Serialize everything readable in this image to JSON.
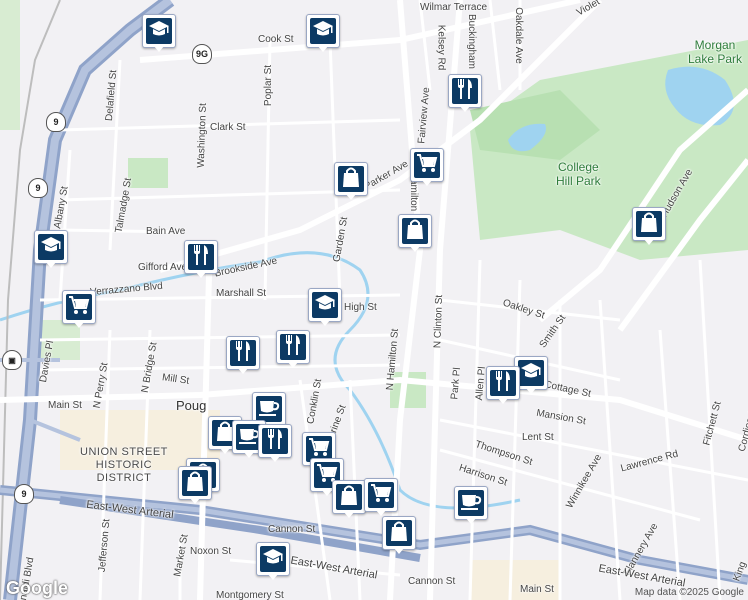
{
  "streets": [
    {
      "name": "Wilmar Terrace",
      "id": "wilmar-terrace"
    },
    {
      "name": "Violet",
      "id": "violet"
    },
    {
      "name": "Oakdale Ave",
      "id": "oakdale-ave"
    },
    {
      "name": "Buckingham",
      "id": "buckingham"
    },
    {
      "name": "Kelsey Rd",
      "id": "kelsey-rd"
    },
    {
      "name": "Cook St",
      "id": "cook-st"
    },
    {
      "name": "Poplar St",
      "id": "poplar-st"
    },
    {
      "name": "Delafield St",
      "id": "delafield-st"
    },
    {
      "name": "Clark St",
      "id": "clark-st"
    },
    {
      "name": "Fairview Ave",
      "id": "fairview-ave"
    },
    {
      "name": "Washington St",
      "id": "washington-st"
    },
    {
      "name": "Talmadge St",
      "id": "talmadge-st"
    },
    {
      "name": "Albany St",
      "id": "albany-st"
    },
    {
      "name": "Parker Ave",
      "id": "parker-ave"
    },
    {
      "name": "Hamilton",
      "id": "hamilton"
    },
    {
      "name": "Bain Ave",
      "id": "bain-ave"
    },
    {
      "name": "Garden St",
      "id": "garden-st"
    },
    {
      "name": "Gifford Ave",
      "id": "gifford-ave"
    },
    {
      "name": "Brookside Ave",
      "id": "brookside-ave"
    },
    {
      "name": "Verrazzano Blvd",
      "id": "verrazzano-blvd"
    },
    {
      "name": "Marshall St",
      "id": "marshall-st"
    },
    {
      "name": "High St",
      "id": "high-st"
    },
    {
      "name": "N Clinton St",
      "id": "n-clinton-st"
    },
    {
      "name": "Oakley St",
      "id": "oakley-st"
    },
    {
      "name": "Smith St",
      "id": "smith-st"
    },
    {
      "name": "Hudson Ave",
      "id": "hudson-ave"
    },
    {
      "name": "N Hamilton St",
      "id": "n-hamilton-st"
    },
    {
      "name": "Davies Pl",
      "id": "davies-pl"
    },
    {
      "name": "N Perry St",
      "id": "n-perry-st"
    },
    {
      "name": "N Bridge St",
      "id": "n-bridge-st"
    },
    {
      "name": "Mill St",
      "id": "mill-st"
    },
    {
      "name": "Main St",
      "id": "main-st-west"
    },
    {
      "name": "Conklin St",
      "id": "conklin-st"
    },
    {
      "name": "Catharine St",
      "id": "catharine-st"
    },
    {
      "name": "Park Pl",
      "id": "park-pl"
    },
    {
      "name": "Allen Pl",
      "id": "allen-pl"
    },
    {
      "name": "Cottage St",
      "id": "cottage-st"
    },
    {
      "name": "Mansion St",
      "id": "mansion-st"
    },
    {
      "name": "Lent St",
      "id": "lent-st"
    },
    {
      "name": "Fitchett St",
      "id": "fitchett-st"
    },
    {
      "name": "Cordies Ave",
      "id": "cordies-ave"
    },
    {
      "name": "Thompson St",
      "id": "thompson-st"
    },
    {
      "name": "Lawrence Rd",
      "id": "lawrence-rd"
    },
    {
      "name": "Harrison St",
      "id": "harrison-st"
    },
    {
      "name": "Winnikee Ave",
      "id": "winnikee-ave"
    },
    {
      "name": "East-West Arterial",
      "id": "east-west-arterial-west"
    },
    {
      "name": "Jefferson St",
      "id": "jefferson-st"
    },
    {
      "name": "Cannon St",
      "id": "cannon-st-west"
    },
    {
      "name": "Noxon St",
      "id": "noxon-st"
    },
    {
      "name": "Market St",
      "id": "market-st"
    },
    {
      "name": "East-West Arterial",
      "id": "east-west-arterial-center"
    },
    {
      "name": "Cannon St",
      "id": "cannon-st-east"
    },
    {
      "name": "Main St",
      "id": "main-st-east"
    },
    {
      "name": "Flannery Ave",
      "id": "flannery-ave"
    },
    {
      "name": "East-West Arterial",
      "id": "east-west-arterial-east"
    },
    {
      "name": "Montgomery St",
      "id": "montgomery-st"
    },
    {
      "name": "Rinaldi Blvd",
      "id": "rinaldi-blvd"
    },
    {
      "name": "King",
      "id": "king"
    }
  ],
  "areas": {
    "morgan_lake_park": "Morgan\nLake Park",
    "college_hill_park": "College\nHill Park",
    "union_street": "UNION STREET\nHISTORIC\nDISTRICT",
    "poughkeepsie": "Poug"
  },
  "shields": {
    "route_9g": "9G",
    "route_9_a": "9",
    "route_9_b": "9",
    "route_9_c": "9",
    "route_44": "9"
  },
  "attribution": "Map data ©2025 Google",
  "logo": "Google",
  "colors": {
    "pin_bg": "#0c3a64",
    "park": "#c9e8c4",
    "water": "#9fd3f0",
    "highway": "#8fa3c9",
    "major": "#ffffff"
  },
  "pins": [
    {
      "id": "school-1",
      "icon": "school"
    },
    {
      "id": "school-2",
      "icon": "school"
    },
    {
      "id": "restaurant-1",
      "icon": "restaurant"
    },
    {
      "id": "grocery-1",
      "icon": "grocery"
    },
    {
      "id": "shopping-1",
      "icon": "shopping"
    },
    {
      "id": "school-3",
      "icon": "school"
    },
    {
      "id": "restaurant-2",
      "icon": "restaurant"
    },
    {
      "id": "shopping-2",
      "icon": "shopping"
    },
    {
      "id": "shopping-3",
      "icon": "shopping"
    },
    {
      "id": "grocery-2",
      "icon": "grocery"
    },
    {
      "id": "school-4",
      "icon": "school"
    },
    {
      "id": "restaurant-3",
      "icon": "restaurant"
    },
    {
      "id": "restaurant-4",
      "icon": "restaurant"
    },
    {
      "id": "school-5",
      "icon": "school"
    },
    {
      "id": "restaurant-5",
      "icon": "restaurant"
    },
    {
      "id": "cafe-1",
      "icon": "cafe"
    },
    {
      "id": "shopping-4",
      "icon": "shopping"
    },
    {
      "id": "cafe-2",
      "icon": "cafe"
    },
    {
      "id": "restaurant-6",
      "icon": "restaurant"
    },
    {
      "id": "shopping-5",
      "icon": "shopping"
    },
    {
      "id": "shopping-6",
      "icon": "shopping"
    },
    {
      "id": "grocery-3",
      "icon": "grocery"
    },
    {
      "id": "grocery-4",
      "icon": "grocery"
    },
    {
      "id": "shopping-7",
      "icon": "shopping"
    },
    {
      "id": "grocery-5",
      "icon": "grocery"
    },
    {
      "id": "shopping-8",
      "icon": "shopping"
    },
    {
      "id": "cafe-3",
      "icon": "cafe"
    },
    {
      "id": "school-6",
      "icon": "school"
    }
  ]
}
